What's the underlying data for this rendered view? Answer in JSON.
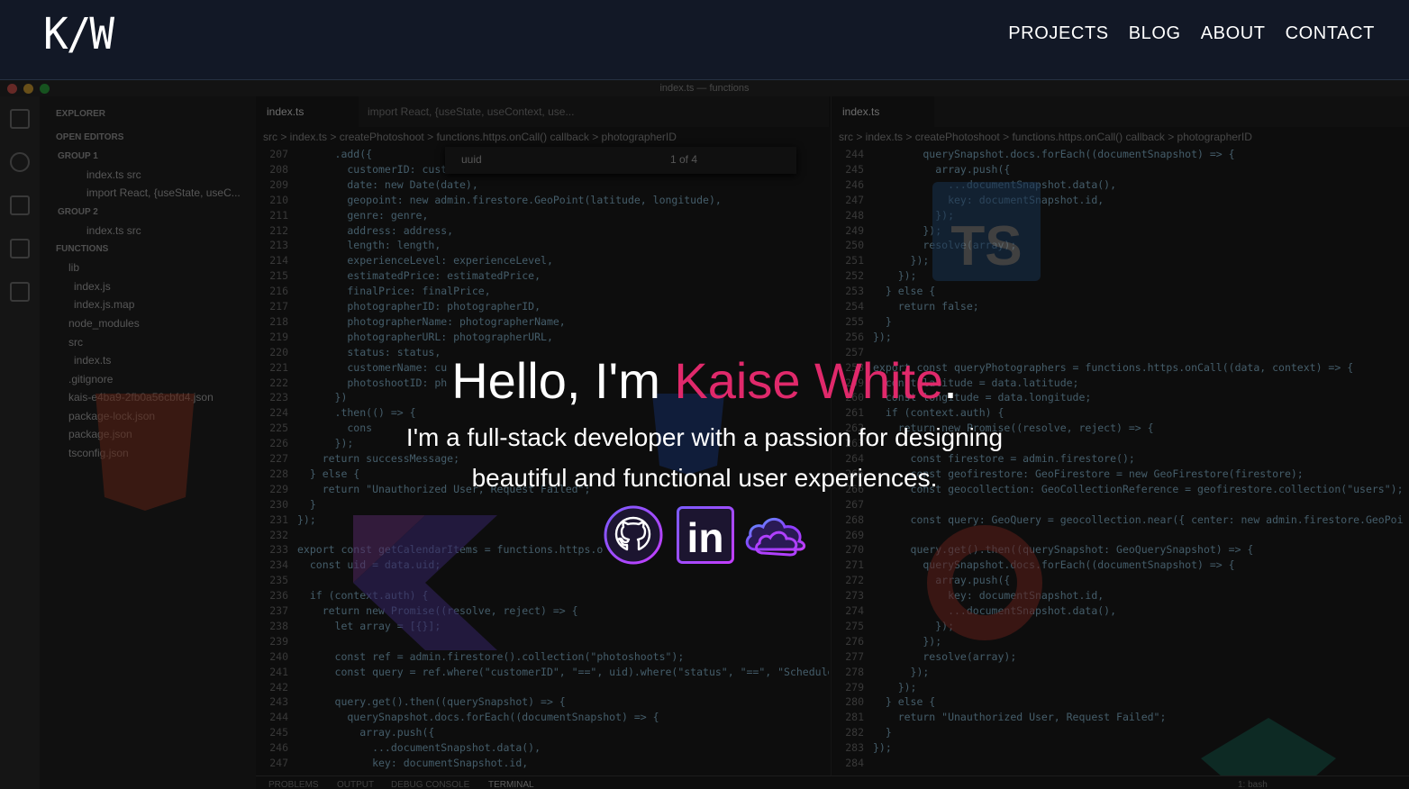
{
  "logo": "K/W",
  "nav": [
    "PROJECTS",
    "BLOG",
    "ABOUT",
    "CONTACT"
  ],
  "hero": {
    "greeting": "Hello, I'm ",
    "name": "Kaise White",
    "period": ".",
    "subtitle_line1": "I'm a full-stack developer with a passion for designing",
    "subtitle_line2": "beautiful and functional user experiences."
  },
  "socials": [
    {
      "name": "github-icon"
    },
    {
      "name": "linkedin-icon",
      "text": "in"
    },
    {
      "name": "cloud-icon"
    }
  ],
  "colors": {
    "accent": "#e0296b",
    "header_bg": "#121826",
    "social_purple": "#8b3dff"
  },
  "editor": {
    "window_title": "index.ts — functions",
    "explorer": {
      "header": "EXPLORER",
      "open_editors": "OPEN EDITORS",
      "group1": "GROUP 1",
      "group1_files": [
        "index.ts  src",
        "import React, {useState, useC..."
      ],
      "group2": "GROUP 2",
      "group2_files": [
        "index.ts  src"
      ],
      "project": "FUNCTIONS",
      "tree": [
        "lib",
        "index.js",
        "index.js.map",
        "node_modules",
        "src",
        "index.ts",
        ".gitignore",
        "kais-e4ba9-2fb0a56cbfd4.json",
        "package-lock.json",
        "package.json",
        "tsconfig.json"
      ]
    },
    "left_tabs": [
      "index.ts",
      "import React, {useState, useContext, use..."
    ],
    "right_tabs": [
      "index.ts"
    ],
    "breadcrumb": "src > index.ts > createPhotoshoot > functions.https.onCall() callback > photographerID",
    "find": {
      "query": "uuid",
      "count": "1 of 4"
    },
    "left_lines": [
      {
        "n": "207",
        "t": "      .add({"
      },
      {
        "n": "208",
        "t": "        customerID: cust"
      },
      {
        "n": "209",
        "t": "        date: new Date(date),"
      },
      {
        "n": "210",
        "t": "        geopoint: new admin.firestore.GeoPoint(latitude, longitude),"
      },
      {
        "n": "211",
        "t": "        genre: genre,"
      },
      {
        "n": "212",
        "t": "        address: address,"
      },
      {
        "n": "213",
        "t": "        length: length,"
      },
      {
        "n": "214",
        "t": "        experienceLevel: experienceLevel,"
      },
      {
        "n": "215",
        "t": "        estimatedPrice: estimatedPrice,"
      },
      {
        "n": "216",
        "t": "        finalPrice: finalPrice,"
      },
      {
        "n": "217",
        "t": "        photographerID: photographerID,"
      },
      {
        "n": "218",
        "t": "        photographerName: photographerName,"
      },
      {
        "n": "219",
        "t": "        photographerURL: photographerURL,"
      },
      {
        "n": "220",
        "t": "        status: status,"
      },
      {
        "n": "221",
        "t": "        customerName: cu"
      },
      {
        "n": "222",
        "t": "        photoshootID: ph"
      },
      {
        "n": "223",
        "t": "      })"
      },
      {
        "n": "224",
        "t": "      .then(() => {"
      },
      {
        "n": "225",
        "t": "        cons"
      },
      {
        "n": "226",
        "t": "      });"
      },
      {
        "n": "227",
        "t": "    return successMessage;"
      },
      {
        "n": "228",
        "t": "  } else {"
      },
      {
        "n": "229",
        "t": "    return \"Unauthorized User, Request Failed\";"
      },
      {
        "n": "230",
        "t": "  }"
      },
      {
        "n": "231",
        "t": "});"
      },
      {
        "n": "232",
        "t": ""
      },
      {
        "n": "233",
        "t": "export const getCalendarItems = functions.https.o"
      },
      {
        "n": "234",
        "t": "  const uid = data.uid;"
      },
      {
        "n": "235",
        "t": ""
      },
      {
        "n": "236",
        "t": "  if (context.auth) {"
      },
      {
        "n": "237",
        "t": "    return new Promise((resolve, reject) => {"
      },
      {
        "n": "238",
        "t": "      let array = [{}];"
      },
      {
        "n": "239",
        "t": ""
      },
      {
        "n": "240",
        "t": "      const ref = admin.firestore().collection(\"photoshoots\");"
      },
      {
        "n": "241",
        "t": "      const query = ref.where(\"customerID\", \"==\", uid).where(\"status\", \"==\", \"Schedule"
      },
      {
        "n": "242",
        "t": ""
      },
      {
        "n": "243",
        "t": "      query.get().then((querySnapshot) => {"
      },
      {
        "n": "244",
        "t": "        querySnapshot.docs.forEach((documentSnapshot) => {"
      },
      {
        "n": "245",
        "t": "          array.push({"
      },
      {
        "n": "246",
        "t": "            ...documentSnapshot.data(),"
      },
      {
        "n": "247",
        "t": "            key: documentSnapshot.id,"
      }
    ],
    "right_lines": [
      {
        "n": "244",
        "t": "        querySnapshot.docs.forEach((documentSnapshot) => {"
      },
      {
        "n": "245",
        "t": "          array.push({"
      },
      {
        "n": "246",
        "t": "            ...documentSnapshot.data(),"
      },
      {
        "n": "247",
        "t": "            key: documentSnapshot.id,"
      },
      {
        "n": "248",
        "t": "          });"
      },
      {
        "n": "249",
        "t": "        });"
      },
      {
        "n": "250",
        "t": "        resolve(array);"
      },
      {
        "n": "251",
        "t": "      });"
      },
      {
        "n": "252",
        "t": "    });"
      },
      {
        "n": "253",
        "t": "  } else {"
      },
      {
        "n": "254",
        "t": "    return false;"
      },
      {
        "n": "255",
        "t": "  }"
      },
      {
        "n": "256",
        "t": "});"
      },
      {
        "n": "257",
        "t": ""
      },
      {
        "n": "258",
        "t": "export const queryPhotographers = functions.https.onCall((data, context) => {"
      },
      {
        "n": "259",
        "t": "  const latitude = data.latitude;"
      },
      {
        "n": "260",
        "t": "  const longitude = data.longitude;"
      },
      {
        "n": "261",
        "t": "  if (context.auth) {"
      },
      {
        "n": "262",
        "t": "    return new Promise((resolve, reject) => {"
      },
      {
        "n": "263",
        "t": "      "
      },
      {
        "n": "264",
        "t": "      const firestore = admin.firestore();"
      },
      {
        "n": "265",
        "t": "      const geofirestore: GeoFirestore = new GeoFirestore(firestore);"
      },
      {
        "n": "266",
        "t": "      const geocollection: GeoCollectionReference = geofirestore.collection(\"users\");"
      },
      {
        "n": "267",
        "t": ""
      },
      {
        "n": "268",
        "t": "      const query: GeoQuery = geocollection.near({ center: new admin.firestore.GeoPoi"
      },
      {
        "n": "269",
        "t": ""
      },
      {
        "n": "270",
        "t": "      query.get().then((querySnapshot: GeoQuerySnapshot) => {"
      },
      {
        "n": "271",
        "t": "        querySnapshot.docs.forEach((documentSnapshot) => {"
      },
      {
        "n": "272",
        "t": "          array.push({"
      },
      {
        "n": "273",
        "t": "            key: documentSnapshot.id,"
      },
      {
        "n": "274",
        "t": "            ...documentSnapshot.data(),"
      },
      {
        "n": "275",
        "t": "          });"
      },
      {
        "n": "276",
        "t": "        });"
      },
      {
        "n": "277",
        "t": "        resolve(array);"
      },
      {
        "n": "278",
        "t": "      });"
      },
      {
        "n": "279",
        "t": "    });"
      },
      {
        "n": "280",
        "t": "  } else {"
      },
      {
        "n": "281",
        "t": "    return \"Unauthorized User, Request Failed\";"
      },
      {
        "n": "282",
        "t": "  }"
      },
      {
        "n": "283",
        "t": "});"
      },
      {
        "n": "284",
        "t": ""
      }
    ],
    "panel_tabs": [
      "PROBLEMS",
      "OUTPUT",
      "DEBUG CONSOLE",
      "TERMINAL"
    ],
    "terminal_label": "1: bash"
  }
}
